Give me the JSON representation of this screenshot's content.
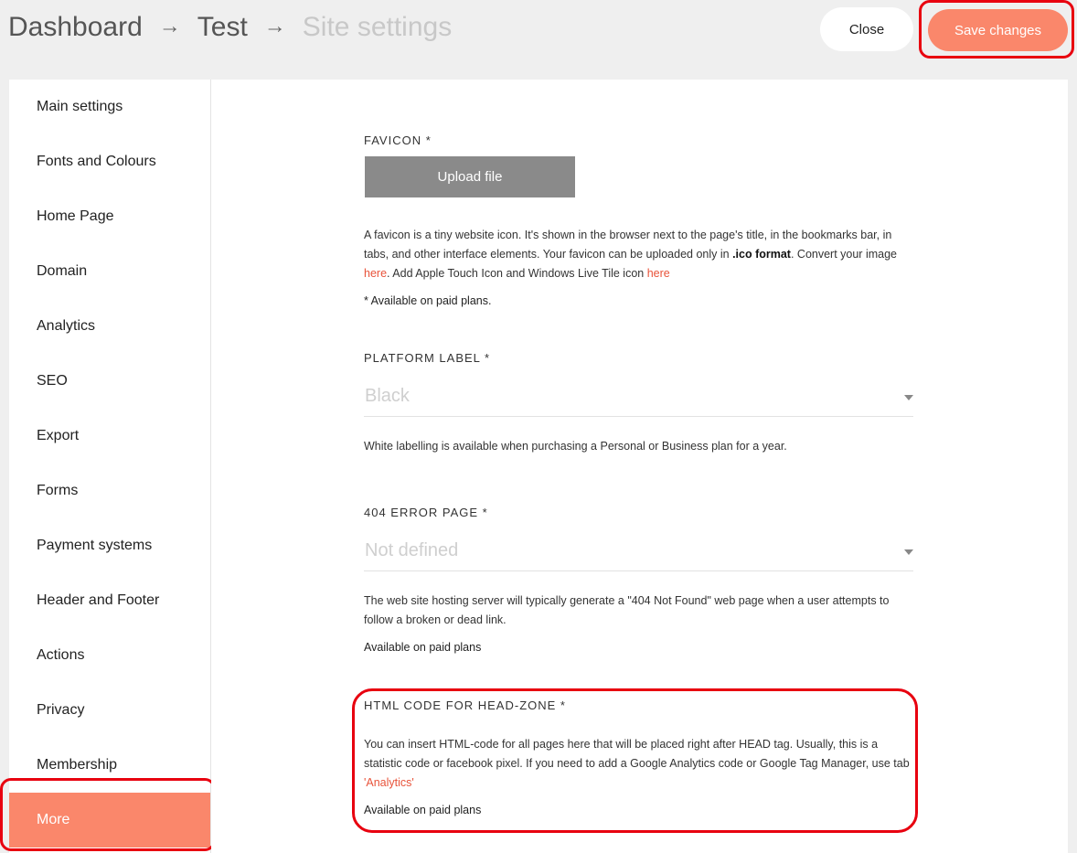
{
  "header": {
    "breadcrumb": [
      "Dashboard",
      "Test",
      "Site settings"
    ],
    "arrow": "→",
    "close_label": "Close",
    "save_label": "Save changes"
  },
  "sidebar": {
    "items": [
      {
        "label": "Main settings"
      },
      {
        "label": "Fonts and Colours"
      },
      {
        "label": "Home Page"
      },
      {
        "label": "Domain"
      },
      {
        "label": "Analytics"
      },
      {
        "label": "SEO"
      },
      {
        "label": "Export"
      },
      {
        "label": "Forms"
      },
      {
        "label": "Payment systems"
      },
      {
        "label": "Header and Footer"
      },
      {
        "label": "Actions"
      },
      {
        "label": "Privacy"
      },
      {
        "label": "Membership"
      },
      {
        "label": "More"
      }
    ],
    "active": "More"
  },
  "favicon": {
    "label": "FAVICON *",
    "upload_label": "Upload file",
    "desc_part1": "A favicon is a tiny website icon. It's shown in the browser next to the page's title, in the bookmarks bar, in tabs, and other interface elements. Your favicon can be uploaded only in ",
    "desc_bold": ".ico format",
    "desc_part2": ". Convert your image ",
    "link_here1": "here",
    "desc_part3": ". Add Apple Touch Icon and Windows Live Tile icon ",
    "link_here2": "here",
    "note": "* Available on paid plans."
  },
  "platform_label": {
    "label": "PLATFORM LABEL *",
    "value": "Black",
    "desc": "White labelling is available when purchasing a Personal or Business plan for a year."
  },
  "error_page": {
    "label": "404 ERROR PAGE *",
    "value": "Not defined",
    "desc": "The web site hosting server will typically generate a \"404 Not Found\" web page when a user attempts to follow a broken or dead link.",
    "note": "Available on paid plans"
  },
  "head_zone": {
    "label": "HTML CODE FOR HEAD-ZONE *",
    "desc_part1": "You can insert HTML-code for all pages here that will be placed right after HEAD tag. Usually, this is a statistic code or facebook pixel. If you need to add a Google Analytics code or Google Tag Manager, use tab ",
    "link": "'Analytics'",
    "note": "Available on paid plans"
  },
  "colors": {
    "accent": "#fa876b",
    "highlight": "#e8000f",
    "link": "#e8533a"
  }
}
